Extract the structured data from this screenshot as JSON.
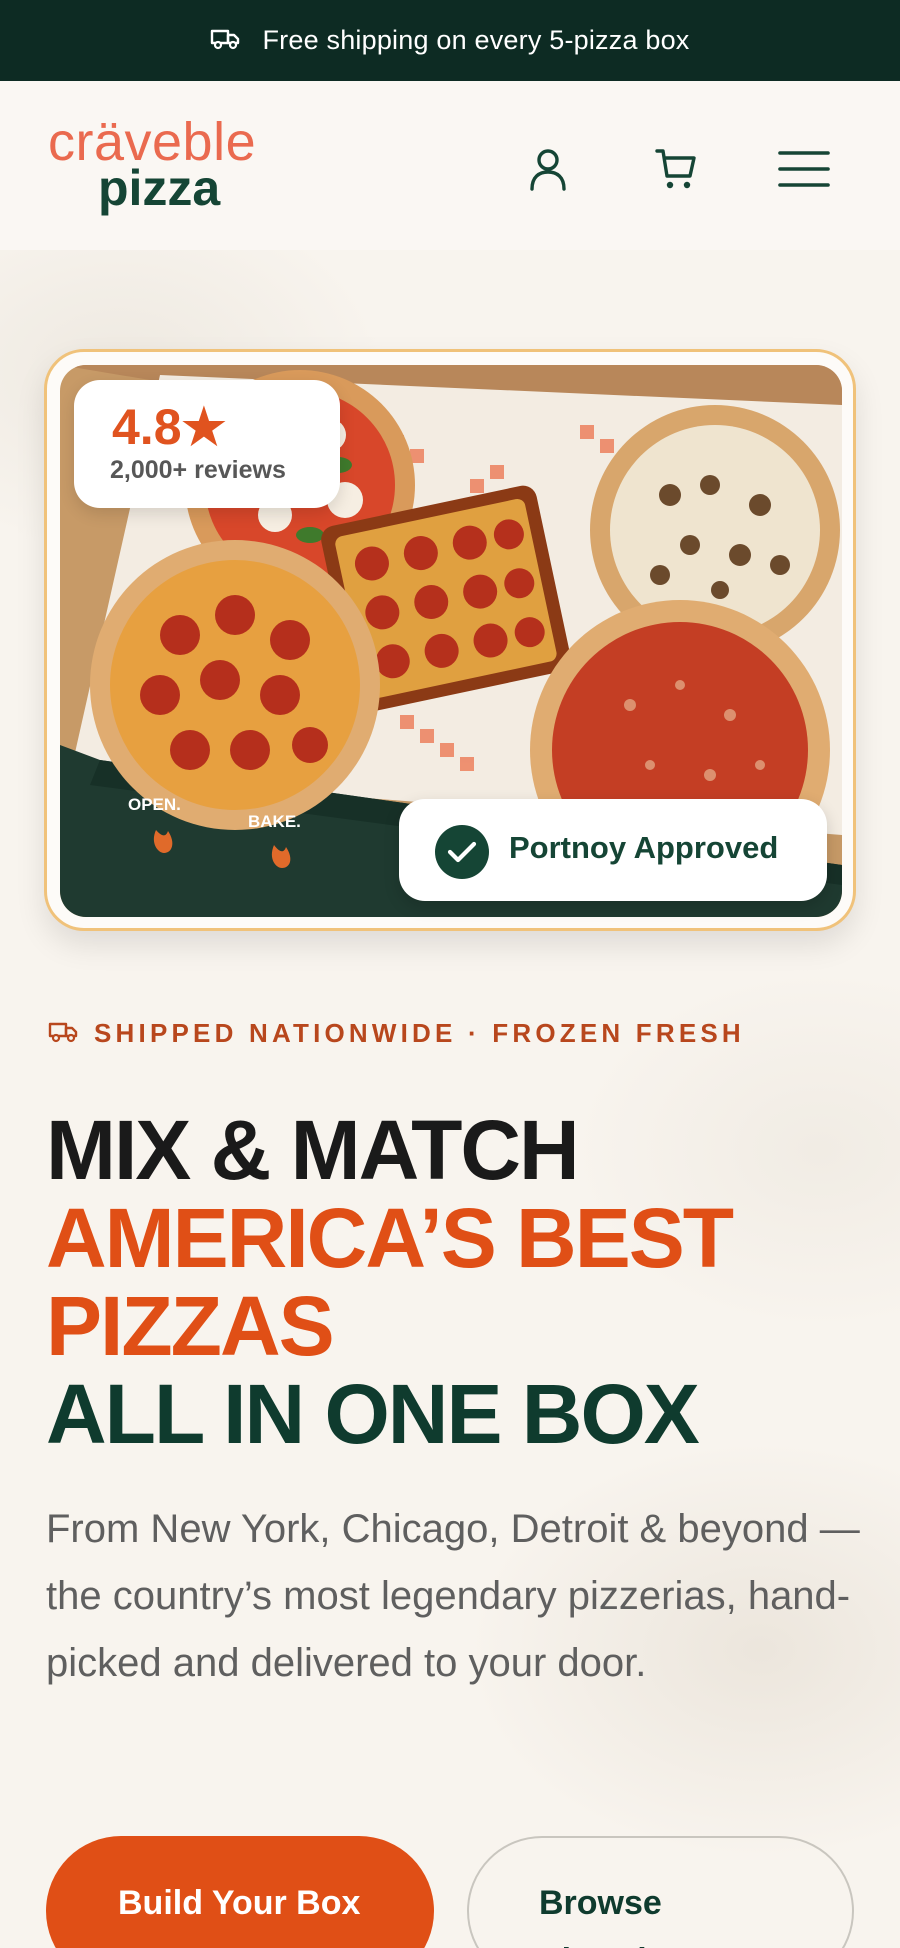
{
  "promo": {
    "icon": "truck-icon",
    "text": "Free shipping on every 5-pizza box"
  },
  "header": {
    "logo_top": "cräveble",
    "logo_bottom": "pizza",
    "icons": [
      "account-icon",
      "cart-icon",
      "menu-icon"
    ]
  },
  "hero": {
    "image_alt": "Box of five assorted pizzas: margherita, mushroom, pepperoni, Detroit-style square pepperoni and salami",
    "box_words": [
      "OPEN.",
      "BAKE."
    ],
    "rating": {
      "value": "4.8★",
      "reviews": "2,000+ reviews"
    },
    "approved": {
      "icon": "check-circle-icon",
      "text": "Portnoy Approved"
    },
    "kicker": {
      "icon": "truck-icon",
      "text": "SHIPPED NATIONWIDE · FROZEN FRESH"
    },
    "headline": {
      "line1": "MIX & MATCH",
      "line2": "AMERICA’S BEST",
      "line3": "PIZZAS",
      "line4": "ALL IN ONE BOX"
    },
    "lede": "From New York, Chicago, Detroit & beyond — the country’s most legendary pizzerias, hand-picked and delivered to your door.",
    "cta_primary": "Build Your Box",
    "cta_secondary": "Browse Pizzerias"
  },
  "colors": {
    "brand_green": "#0d2b23",
    "brand_orange": "#e04f16",
    "logo_coral": "#ea6a4f",
    "card_border": "#f0c27a"
  }
}
